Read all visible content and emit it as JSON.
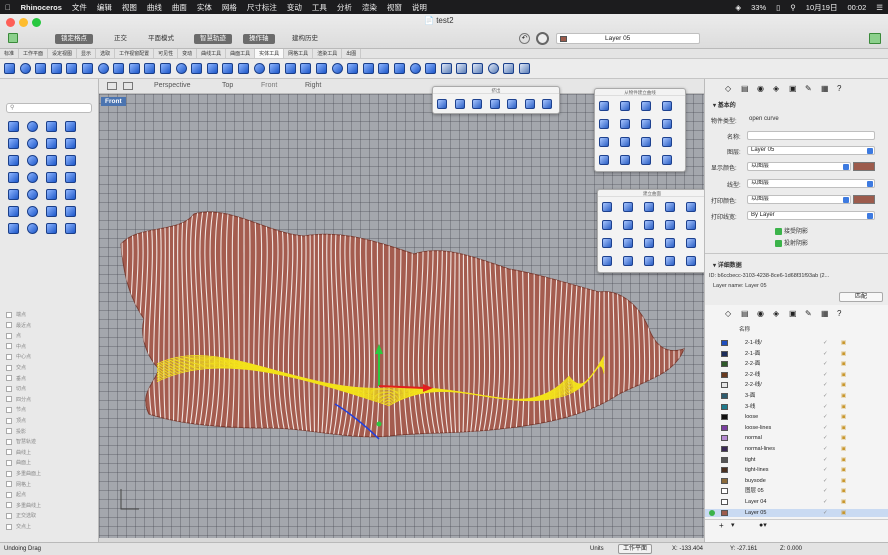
{
  "menubar": {
    "app": "Rhinoceros",
    "items": [
      "文件",
      "编辑",
      "视图",
      "曲线",
      "曲面",
      "实体",
      "网格",
      "尺寸标注",
      "变动",
      "工具",
      "分析",
      "渲染",
      "视窗",
      "说明"
    ],
    "battery": "33%",
    "date": "10月19日",
    "time": "00:02"
  },
  "titlebar": {
    "doc_title": "test2",
    "buttons": [
      {
        "label": "锁定格点",
        "on": true
      },
      {
        "label": "正交",
        "on": false
      },
      {
        "label": "平面模式",
        "on": false
      },
      {
        "label": "智慧轨迹",
        "on": true
      },
      {
        "label": "操作轴",
        "on": true
      },
      {
        "label": "建构历史",
        "on": false
      }
    ],
    "layer_current": "Layer 05"
  },
  "toolbar_tabs": [
    "标准",
    "工作平面",
    "设定视图",
    "显示",
    "选取",
    "工作视窗配置",
    "可见性",
    "变动",
    "曲线工具",
    "曲面工具",
    "实体工具",
    "网格工具",
    "渲染工具",
    "出图"
  ],
  "viewports": {
    "tabs": [
      "Perspective",
      "Top",
      "Front",
      "Right"
    ],
    "active": "Front",
    "label": "Front"
  },
  "floating_panels": [
    "挤出",
    "从物件建立曲线",
    "建立曲面"
  ],
  "properties": {
    "header": "基本的",
    "object_type_label": "物件类型:",
    "object_type": "open curve",
    "name_label": "名称:",
    "name_value": "",
    "layer_label": "图层:",
    "layer_value": "Layer 05",
    "display_color_label": "显示颜色:",
    "display_color_value": "以图层",
    "linetype_label": "线型:",
    "linetype_value": "以图层",
    "print_color_label": "打印颜色:",
    "print_color_value": "以图层",
    "print_width_label": "打印线宽:",
    "print_width_value": "By Layer",
    "cast_shadow": "接受阴影",
    "receive_shadow": "投射阴影",
    "details_header": "详细数据",
    "id_text": "ID: b6ccbecc-3103-4238-8ce6-1d68f31f93ab (2...",
    "layer_name_text": "Layer name: Layer 05",
    "match_button": "匹配",
    "color_swatch": "#9c5b4c"
  },
  "layers": {
    "header": "名称",
    "rows": [
      {
        "name": "2-1-线/",
        "color": "#1f4fbf"
      },
      {
        "name": "2-1-面",
        "color": "#1b2c5a"
      },
      {
        "name": "2-2-面",
        "color": "#2f5a2a"
      },
      {
        "name": "2-2-线",
        "color": "#6a3b1f"
      },
      {
        "name": "2-2-线/",
        "color": "#e6e6e6"
      },
      {
        "name": "3-面",
        "color": "#2d5c6e"
      },
      {
        "name": "3-线",
        "color": "#1e7a8c"
      },
      {
        "name": "loose",
        "color": "#111111"
      },
      {
        "name": "loose-lines",
        "color": "#7a3fa0"
      },
      {
        "name": "normal",
        "color": "#b58ad1"
      },
      {
        "name": "normal-lines",
        "color": "#3a2a55"
      },
      {
        "name": "tight",
        "color": "#555555"
      },
      {
        "name": "tight-lines",
        "color": "#4a3020"
      },
      {
        "name": "buysode",
        "color": "#8b6a3a"
      },
      {
        "name": "图层 05",
        "color": "#ffffff"
      },
      {
        "name": "Layer 04",
        "color": "#ffffff"
      },
      {
        "name": "Layer 05",
        "color": "#9c5b4c",
        "selected": true
      }
    ]
  },
  "left_panel_osnaps": [
    "端点",
    "最近点",
    "点",
    "中点",
    "中心点",
    "交点",
    "垂点",
    "切点",
    "四分点",
    "节点",
    "顶点",
    "投影",
    "智慧轨迹",
    "曲线上",
    "曲面上",
    "多重曲面上",
    "网格上",
    "起点",
    "多重曲线上",
    "正交选取",
    "交点上"
  ],
  "statusbar": {
    "command": "Undoing Drag",
    "units": "Units",
    "cplane": "工作平面",
    "x": "X: -133.404",
    "y": "Y: -27.161",
    "z": "Z: 0.000"
  }
}
